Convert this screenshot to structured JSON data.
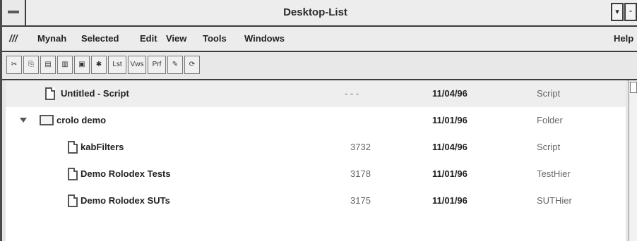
{
  "window": {
    "title": "Desktop-List",
    "controls": {
      "sysmenu_icon": "system-menu",
      "minimize_glyph": "▾",
      "maximize_glyph": "⁃"
    }
  },
  "menubar": {
    "logo_glyph": "///",
    "items": [
      {
        "label": "Mynah"
      },
      {
        "label": "Selected"
      },
      {
        "label": "Edit"
      },
      {
        "label": "View"
      },
      {
        "label": "Tools"
      },
      {
        "label": "Windows"
      }
    ],
    "help_label": "Help"
  },
  "toolbar": {
    "buttons": [
      {
        "icon": "settings-icon",
        "glyph": "✂"
      },
      {
        "icon": "copy-icon",
        "glyph": "⎘"
      },
      {
        "icon": "paste-icon",
        "glyph": "▤"
      },
      {
        "icon": "archive-icon",
        "glyph": "▥"
      },
      {
        "icon": "save-icon",
        "glyph": "▣"
      },
      {
        "icon": "run-icon",
        "glyph": "✱"
      },
      {
        "icon": "list-icon",
        "glyph": "Lst"
      },
      {
        "icon": "views-icon",
        "glyph": "Vws"
      },
      {
        "icon": "print-icon",
        "glyph": "Prf"
      },
      {
        "icon": "edit-icon",
        "glyph": "✎"
      },
      {
        "icon": "refresh-icon",
        "glyph": "⟳"
      }
    ]
  },
  "list": {
    "rows": [
      {
        "name": "Untitled - Script",
        "size": "- - -",
        "date": "11/04/96",
        "type": "Script",
        "kind": "file"
      },
      {
        "name": "crolo demo",
        "size": "",
        "date": "11/01/96",
        "type": "Folder",
        "kind": "folder"
      },
      {
        "name": "kabFilters",
        "size": "3732",
        "date": "11/04/96",
        "type": "Script",
        "kind": "file"
      },
      {
        "name": "Demo Rolodex Tests",
        "size": "3178",
        "date": "11/01/96",
        "type": "TestHier",
        "kind": "file"
      },
      {
        "name": "Demo Rolodex SUTs",
        "size": "3175",
        "date": "11/01/96",
        "type": "SUTHier",
        "kind": "file"
      }
    ]
  }
}
